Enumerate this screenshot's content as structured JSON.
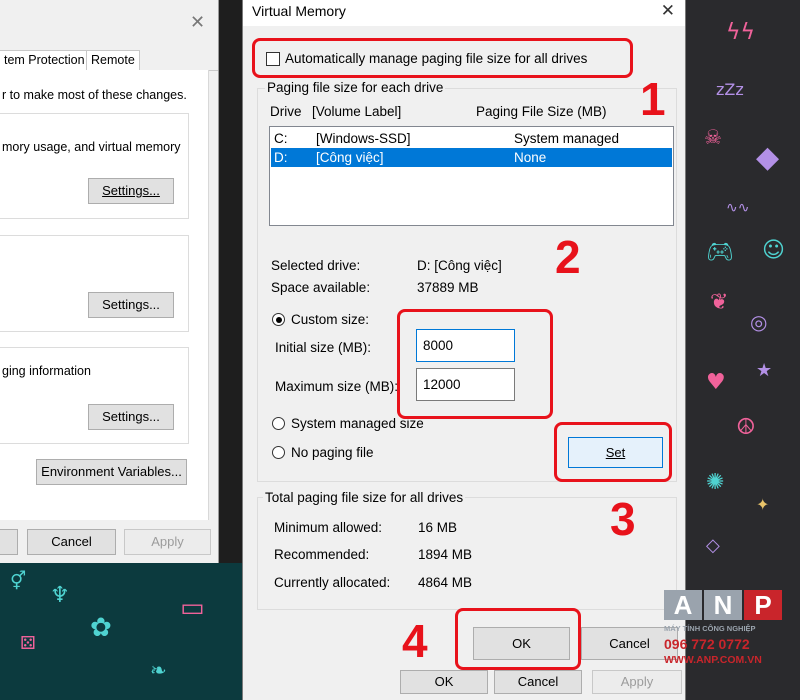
{
  "system_properties": {
    "tabs": [
      "tem Protection",
      "Remote"
    ],
    "note": "r to make most of these changes.",
    "performance_text": "mory usage, and virtual memory",
    "paging_info_text": "ging information",
    "settings_label": "Settings...",
    "env_vars_label": "Environment Variables...",
    "cancel_label": "Cancel",
    "apply_label": "Apply"
  },
  "dialog": {
    "title": "Virtual Memory",
    "auto_manage_label": "Automatically manage paging file size for all drives",
    "auto_manage_checked": false,
    "group_title": "Paging file size for each drive",
    "columns": [
      "Drive",
      "[Volume Label]",
      "Paging File Size (MB)"
    ],
    "drives": [
      {
        "drive": "C:",
        "label": "[Windows-SSD]",
        "size": "System managed",
        "selected": false
      },
      {
        "drive": "D:",
        "label": "[Công việc]",
        "size": "None",
        "selected": true
      }
    ],
    "selected_drive_label": "Selected drive:",
    "selected_drive_value": "D:  [Công việc]",
    "space_label": "Space available:",
    "space_value": "37889 MB",
    "custom_size_label": "Custom size:",
    "initial_size_label": "Initial size (MB):",
    "initial_size_value": "8000",
    "maximum_size_label": "Maximum size (MB):",
    "maximum_size_value": "12000",
    "system_managed_label": "System managed size",
    "no_paging_label": "No paging file",
    "set_label": "Set",
    "total_group_title": "Total paging file size for all drives",
    "minimum_label": "Minimum allowed:",
    "minimum_value": "16 MB",
    "recommended_label": "Recommended:",
    "recommended_value": "1894 MB",
    "allocated_label": "Currently allocated:",
    "allocated_value": "4864 MB",
    "ok_label": "OK",
    "cancel_label": "Cancel"
  },
  "behind_buttons": {
    "ok": "OK",
    "cancel": "Cancel",
    "apply": "Apply"
  },
  "annotations": {
    "step1": "1",
    "step2": "2",
    "step3": "3",
    "step4": "4",
    "color": "#e8121b"
  },
  "watermark": {
    "letters": [
      "A",
      "N",
      "P"
    ],
    "line1": "MÁY TÍNH CÔNG NGHIỆP",
    "phone": "096 772 0772",
    "site": "WWW.ANP.COM.VN"
  },
  "accent": "#0078d7"
}
